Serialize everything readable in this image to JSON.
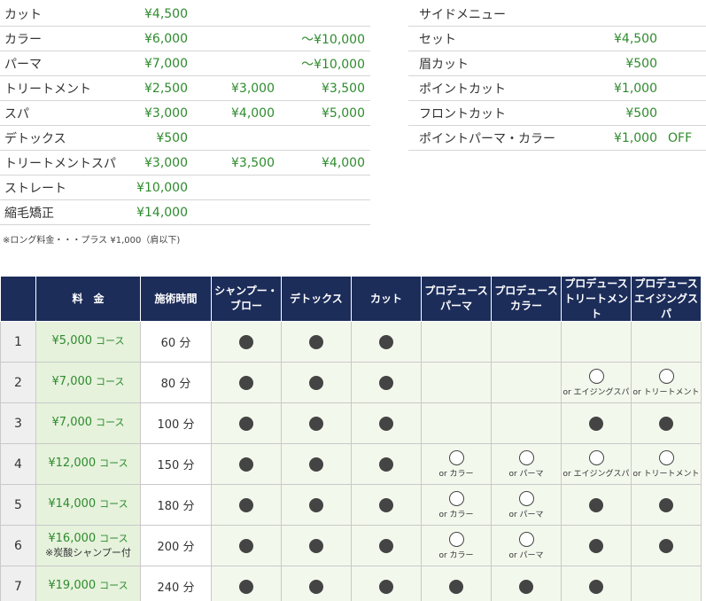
{
  "main_prices": [
    {
      "name": "カット",
      "p1": "¥4,500",
      "p2": "",
      "p3": ""
    },
    {
      "name": "カラー",
      "p1": "¥6,000",
      "p2": "",
      "p3": "〜¥10,000"
    },
    {
      "name": "パーマ",
      "p1": "¥7,000",
      "p2": "",
      "p3": "〜¥10,000"
    },
    {
      "name": "トリートメント",
      "p1": "¥2,500",
      "p2": "¥3,000",
      "p3": "¥3,500"
    },
    {
      "name": "スパ",
      "p1": "¥3,000",
      "p2": "¥4,000",
      "p3": "¥5,000"
    },
    {
      "name": "デトックス",
      "p1": "¥500",
      "p2": "",
      "p3": ""
    },
    {
      "name": "トリートメントスパ",
      "p1": "¥3,000",
      "p2": "¥3,500",
      "p3": "¥4,000"
    },
    {
      "name": "ストレート",
      "p1": "¥10,000",
      "p2": "",
      "p3": ""
    },
    {
      "name": "縮毛矯正",
      "p1": "¥14,000",
      "p2": "",
      "p3": ""
    }
  ],
  "main_note": "※ロング料金・・・プラス ¥1,000（肩以下)",
  "side_menu": {
    "title": "サイドメニュー",
    "items": [
      {
        "name": "セット",
        "price": "¥4,500",
        "extra": ""
      },
      {
        "name": "眉カット",
        "price": "¥500",
        "extra": ""
      },
      {
        "name": "ポイントカット",
        "price": "¥1,000",
        "extra": ""
      },
      {
        "name": "フロントカット",
        "price": "¥500",
        "extra": ""
      },
      {
        "name": "ポイントパーマ・カラー",
        "price": "¥1,000",
        "extra": "OFF"
      }
    ]
  },
  "course_table": {
    "headers": {
      "no": "",
      "price": "料　金",
      "time": "施術時間",
      "shampoo_1": "シャンプー・",
      "shampoo_2": "ブロー",
      "detox": "デトックス",
      "cut": "カット",
      "perm_1": "プロデュース",
      "perm_2": "パーマ",
      "color_1": "プロデュース",
      "color_2": "カラー",
      "treat_1": "プロデュース",
      "treat_2": "トリートメント",
      "spa_1": "プロデュース",
      "spa_2": "エイジングスパ"
    },
    "rows": [
      {
        "no": "1",
        "price": "¥5,000",
        "unit": "コース",
        "sub": "",
        "time": "60 分",
        "cells": [
          "dot",
          "dot",
          "dot",
          "",
          "",
          "",
          ""
        ],
        "opts": [
          "",
          "",
          "",
          "",
          "",
          "",
          ""
        ]
      },
      {
        "no": "2",
        "price": "¥7,000",
        "unit": "コース",
        "sub": "",
        "time": "80 分",
        "cells": [
          "dot",
          "dot",
          "dot",
          "",
          "",
          "ring",
          "ring"
        ],
        "opts": [
          "",
          "",
          "",
          "",
          "",
          "or エイジングスパ",
          "or トリートメント"
        ]
      },
      {
        "no": "3",
        "price": "¥7,000",
        "unit": "コース",
        "sub": "",
        "time": "100 分",
        "cells": [
          "dot",
          "dot",
          "dot",
          "",
          "",
          "dot",
          "dot"
        ],
        "opts": [
          "",
          "",
          "",
          "",
          "",
          "",
          ""
        ]
      },
      {
        "no": "4",
        "price": "¥12,000",
        "unit": "コース",
        "sub": "",
        "time": "150 分",
        "cells": [
          "dot",
          "dot",
          "dot",
          "ring",
          "ring",
          "ring",
          "ring"
        ],
        "opts": [
          "",
          "",
          "",
          "or カラー",
          "or パーマ",
          "or エイジングスパ",
          "or トリートメント"
        ]
      },
      {
        "no": "5",
        "price": "¥14,000",
        "unit": "コース",
        "sub": "",
        "time": "180 分",
        "cells": [
          "dot",
          "dot",
          "dot",
          "ring",
          "ring",
          "dot",
          "dot"
        ],
        "opts": [
          "",
          "",
          "",
          "or カラー",
          "or パーマ",
          "",
          ""
        ]
      },
      {
        "no": "6",
        "price": "¥16,000",
        "unit": "コース",
        "sub": "※炭酸シャンプー付",
        "time": "200 分",
        "cells": [
          "dot",
          "dot",
          "dot",
          "ring",
          "ring",
          "dot",
          "dot"
        ],
        "opts": [
          "",
          "",
          "",
          "or カラー",
          "or パーマ",
          "",
          ""
        ]
      },
      {
        "no": "7",
        "price": "¥19,000",
        "unit": "コース",
        "sub": "",
        "time": "240 分",
        "cells": [
          "dot",
          "dot",
          "dot",
          "dot",
          "dot",
          "dot",
          ""
        ],
        "opts": [
          "",
          "",
          "",
          "",
          "",
          "",
          ""
        ]
      }
    ]
  },
  "colors": {
    "accent_green": "#2e8b2e",
    "header_navy": "#1c2d5a",
    "cell_bg": "#f3f8ec"
  }
}
